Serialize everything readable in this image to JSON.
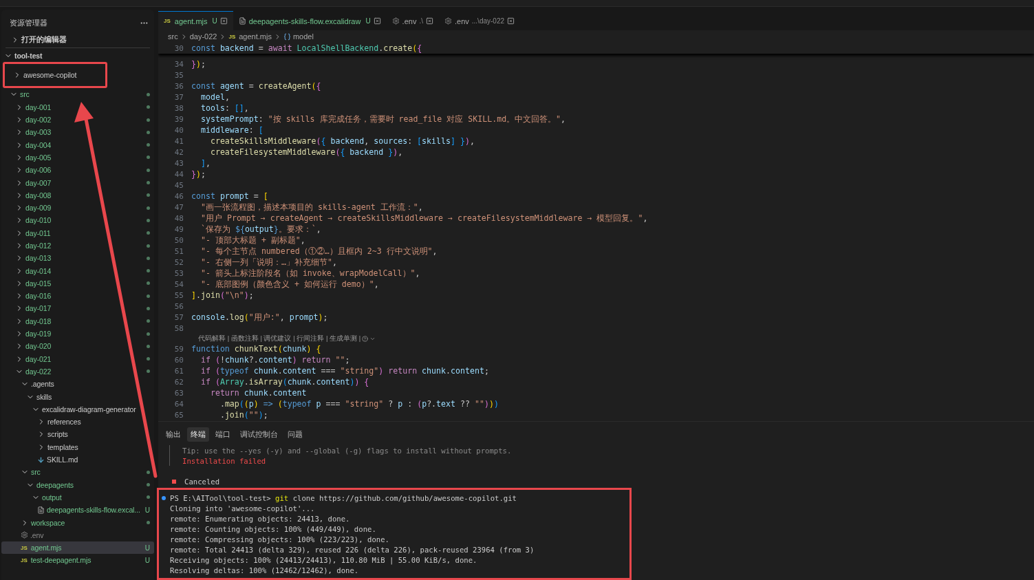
{
  "explorer": {
    "title": "资源管理器",
    "sections": [
      {
        "label": "打开的编辑器",
        "expanded": false
      }
    ],
    "root": {
      "name": "tool-test",
      "expanded": true,
      "children": [
        {
          "name": "awesome-copilot",
          "kind": "folder",
          "expanded": false,
          "untracked": false,
          "dot": false,
          "selected": false,
          "annotated": true
        },
        {
          "name": "src",
          "kind": "folder",
          "expanded": true,
          "untracked": true,
          "dot": true,
          "selected": false,
          "children": [
            {
              "name": "day-001",
              "kind": "folder",
              "expanded": false,
              "untracked": true,
              "dot": true,
              "selected": false
            },
            {
              "name": "day-002",
              "kind": "folder",
              "expanded": false,
              "untracked": true,
              "dot": true,
              "selected": false
            },
            {
              "name": "day-003",
              "kind": "folder",
              "expanded": false,
              "untracked": true,
              "dot": true,
              "selected": false
            },
            {
              "name": "day-004",
              "kind": "folder",
              "expanded": false,
              "untracked": true,
              "dot": true,
              "selected": false
            },
            {
              "name": "day-005",
              "kind": "folder",
              "expanded": false,
              "untracked": true,
              "dot": true,
              "selected": false
            },
            {
              "name": "day-006",
              "kind": "folder",
              "expanded": false,
              "untracked": true,
              "dot": true,
              "selected": false
            },
            {
              "name": "day-007",
              "kind": "folder",
              "expanded": false,
              "untracked": true,
              "dot": true,
              "selected": false
            },
            {
              "name": "day-008",
              "kind": "folder",
              "expanded": false,
              "untracked": true,
              "dot": true,
              "selected": false
            },
            {
              "name": "day-009",
              "kind": "folder",
              "expanded": false,
              "untracked": true,
              "dot": true,
              "selected": false
            },
            {
              "name": "day-010",
              "kind": "folder",
              "expanded": false,
              "untracked": true,
              "dot": true,
              "selected": false
            },
            {
              "name": "day-011",
              "kind": "folder",
              "expanded": false,
              "untracked": true,
              "dot": true,
              "selected": false
            },
            {
              "name": "day-012",
              "kind": "folder",
              "expanded": false,
              "untracked": true,
              "dot": true,
              "selected": false
            },
            {
              "name": "day-013",
              "kind": "folder",
              "expanded": false,
              "untracked": true,
              "dot": true,
              "selected": false
            },
            {
              "name": "day-014",
              "kind": "folder",
              "expanded": false,
              "untracked": true,
              "dot": true,
              "selected": false
            },
            {
              "name": "day-015",
              "kind": "folder",
              "expanded": false,
              "untracked": true,
              "dot": true,
              "selected": false
            },
            {
              "name": "day-016",
              "kind": "folder",
              "expanded": false,
              "untracked": true,
              "dot": true,
              "selected": false
            },
            {
              "name": "day-017",
              "kind": "folder",
              "expanded": false,
              "untracked": true,
              "dot": true,
              "selected": false
            },
            {
              "name": "day-018",
              "kind": "folder",
              "expanded": false,
              "untracked": true,
              "dot": true,
              "selected": false
            },
            {
              "name": "day-019",
              "kind": "folder",
              "expanded": false,
              "untracked": true,
              "dot": true,
              "selected": false
            },
            {
              "name": "day-020",
              "kind": "folder",
              "expanded": false,
              "untracked": true,
              "dot": true,
              "selected": false
            },
            {
              "name": "day-021",
              "kind": "folder",
              "expanded": false,
              "untracked": true,
              "dot": true,
              "selected": false
            },
            {
              "name": "day-022",
              "kind": "folder",
              "expanded": true,
              "untracked": true,
              "dot": true,
              "selected": false,
              "children": [
                {
                  "name": ".agents",
                  "kind": "folder",
                  "expanded": true,
                  "untracked": false,
                  "dot": false,
                  "selected": false,
                  "children": [
                    {
                      "name": "skills",
                      "kind": "folder",
                      "expanded": true,
                      "untracked": false,
                      "dot": false,
                      "selected": false,
                      "children": [
                        {
                          "name": "excalidraw-diagram-generator",
                          "kind": "folder",
                          "expanded": true,
                          "untracked": false,
                          "dot": false,
                          "selected": false,
                          "children": [
                            {
                              "name": "references",
                              "kind": "folder",
                              "expanded": false,
                              "untracked": false,
                              "dot": false,
                              "selected": false
                            },
                            {
                              "name": "scripts",
                              "kind": "folder",
                              "expanded": false,
                              "untracked": false,
                              "dot": false,
                              "selected": false
                            },
                            {
                              "name": "templates",
                              "kind": "folder",
                              "expanded": false,
                              "untracked": false,
                              "dot": false,
                              "selected": false
                            },
                            {
                              "name": "SKILL.md",
                              "kind": "markdown-file",
                              "untracked": false,
                              "dot": false,
                              "selected": false
                            }
                          ]
                        }
                      ]
                    }
                  ]
                },
                {
                  "name": "src",
                  "kind": "folder",
                  "expanded": true,
                  "untracked": true,
                  "dot": true,
                  "selected": false,
                  "children": [
                    {
                      "name": "deepagents",
                      "kind": "folder",
                      "expanded": true,
                      "untracked": true,
                      "dot": true,
                      "selected": false,
                      "children": [
                        {
                          "name": "output",
                          "kind": "folder",
                          "expanded": true,
                          "untracked": true,
                          "dot": true,
                          "selected": false,
                          "children": [
                            {
                              "name": "deepagents-skills-flow.excal...",
                              "kind": "document-file",
                              "untracked": true,
                              "dot": false,
                              "badge": "U",
                              "selected": false
                            }
                          ]
                        }
                      ]
                    }
                  ]
                },
                {
                  "name": "workspace",
                  "kind": "folder",
                  "expanded": false,
                  "untracked": true,
                  "dot": true,
                  "selected": false
                },
                {
                  "name": ".env",
                  "kind": "settings-file",
                  "untracked": false,
                  "dimmed": true,
                  "dot": false,
                  "selected": false
                },
                {
                  "name": "agent.mjs",
                  "kind": "js-file",
                  "icon_label": "JS",
                  "untracked": true,
                  "dot": false,
                  "badge": "U",
                  "selected": true
                },
                {
                  "name": "test-deepagent.mjs",
                  "kind": "js-file",
                  "icon_label": "JS",
                  "untracked": true,
                  "dot": false,
                  "badge": "U",
                  "selected": false
                }
              ]
            }
          ]
        }
      ]
    }
  },
  "tabs": [
    {
      "label": "agent.mjs",
      "kind": "js-file",
      "icon_label": "JS",
      "badge": "U",
      "untracked": true,
      "selected": true
    },
    {
      "label": "deepagents-skills-flow.excalidraw",
      "kind": "document-file",
      "badge": "U",
      "untracked": true,
      "selected": false
    },
    {
      "label": ".env",
      "kind": "settings-file",
      "description": ".\\",
      "untracked": false,
      "selected": false
    },
    {
      "label": ".env",
      "kind": "settings-file",
      "description": "...\\day-022",
      "untracked": false,
      "selected": false
    }
  ],
  "breadcrumbs": [
    {
      "label": "src",
      "kind": "folder"
    },
    {
      "label": "day-022",
      "kind": "folder"
    },
    {
      "label": "agent.mjs",
      "kind": "js-file",
      "icon_label": "JS"
    },
    {
      "label": "model",
      "kind": "symbol"
    }
  ],
  "editor": {
    "sticky_line": {
      "number": "30",
      "tokens": [
        {
          "kind": "kw",
          "text": "const "
        },
        {
          "kind": "var",
          "text": "backend"
        },
        {
          "kind": "plain",
          "text": " = "
        },
        {
          "kind": "ctl",
          "text": "await "
        },
        {
          "kind": "type",
          "text": "LocalShellBackend"
        },
        {
          "kind": "plain",
          "text": "."
        },
        {
          "kind": "fn",
          "text": "create"
        },
        {
          "kind": "br1",
          "text": "("
        },
        {
          "kind": "br2",
          "text": "{"
        }
      ]
    },
    "lines": [
      {
        "kind": "code",
        "number": "34",
        "tokens": [
          {
            "kind": "br2",
            "text": "}"
          },
          {
            "kind": "br1",
            "text": ")"
          },
          {
            "kind": "plain",
            "text": ";"
          }
        ]
      },
      {
        "kind": "code",
        "number": "35"
      },
      {
        "kind": "code",
        "number": "36",
        "tokens": [
          {
            "kind": "kw",
            "text": "const "
          },
          {
            "kind": "var",
            "text": "agent"
          },
          {
            "kind": "plain",
            "text": " = "
          },
          {
            "kind": "fn",
            "text": "createAgent"
          },
          {
            "kind": "br1",
            "text": "("
          },
          {
            "kind": "br2",
            "text": "{"
          }
        ]
      },
      {
        "kind": "code",
        "number": "37",
        "tokens": [
          {
            "kind": "var",
            "text": "  model"
          },
          {
            "kind": "plain",
            "text": ","
          }
        ]
      },
      {
        "kind": "code",
        "number": "38",
        "tokens": [
          {
            "kind": "var",
            "text": "  tools"
          },
          {
            "kind": "plain",
            "text": ": "
          },
          {
            "kind": "br3",
            "text": "[]"
          },
          {
            "kind": "plain",
            "text": ","
          }
        ]
      },
      {
        "kind": "code",
        "number": "39",
        "tokens": [
          {
            "kind": "var",
            "text": "  systemPrompt"
          },
          {
            "kind": "plain",
            "text": ": "
          },
          {
            "kind": "str",
            "text": "\"按 skills 库完成任务，需要时 read_file 对应 SKILL.md。中文回答。\""
          },
          {
            "kind": "plain",
            "text": ","
          }
        ]
      },
      {
        "kind": "code",
        "number": "40",
        "tokens": [
          {
            "kind": "var",
            "text": "  middleware"
          },
          {
            "kind": "plain",
            "text": ": "
          },
          {
            "kind": "br3",
            "text": "["
          }
        ]
      },
      {
        "kind": "code",
        "number": "41",
        "tokens": [
          {
            "kind": "fn",
            "text": "    createSkillsMiddleware"
          },
          {
            "kind": "br2",
            "text": "("
          },
          {
            "kind": "br3",
            "text": "{"
          },
          {
            "kind": "var",
            "text": " backend"
          },
          {
            "kind": "plain",
            "text": ", "
          },
          {
            "kind": "var",
            "text": "sources"
          },
          {
            "kind": "plain",
            "text": ": "
          },
          {
            "kind": "br3",
            "text": "["
          },
          {
            "kind": "var",
            "text": "skills"
          },
          {
            "kind": "br3",
            "text": "]"
          },
          {
            "kind": "br3",
            "text": " }"
          },
          {
            "kind": "br2",
            "text": ")"
          },
          {
            "kind": "plain",
            "text": ","
          }
        ]
      },
      {
        "kind": "code",
        "number": "42",
        "tokens": [
          {
            "kind": "fn",
            "text": "    createFilesystemMiddleware"
          },
          {
            "kind": "br2",
            "text": "("
          },
          {
            "kind": "br3",
            "text": "{"
          },
          {
            "kind": "var",
            "text": " backend"
          },
          {
            "kind": "br3",
            "text": " }"
          },
          {
            "kind": "br2",
            "text": ")"
          },
          {
            "kind": "plain",
            "text": ","
          }
        ]
      },
      {
        "kind": "code",
        "number": "43",
        "tokens": [
          {
            "kind": "br3",
            "text": "  ]"
          },
          {
            "kind": "plain",
            "text": ","
          }
        ]
      },
      {
        "kind": "code",
        "number": "44",
        "tokens": [
          {
            "kind": "br2",
            "text": "}"
          },
          {
            "kind": "br1",
            "text": ")"
          },
          {
            "kind": "plain",
            "text": ";"
          }
        ]
      },
      {
        "kind": "code",
        "number": "45"
      },
      {
        "kind": "code",
        "number": "46",
        "tokens": [
          {
            "kind": "kw",
            "text": "const "
          },
          {
            "kind": "var",
            "text": "prompt"
          },
          {
            "kind": "plain",
            "text": " = "
          },
          {
            "kind": "br1",
            "text": "["
          }
        ]
      },
      {
        "kind": "code",
        "number": "47",
        "tokens": [
          {
            "kind": "str",
            "text": "  \"画一张流程图，描述本项目的 skills-agent 工作流：\""
          },
          {
            "kind": "plain",
            "text": ","
          }
        ]
      },
      {
        "kind": "code",
        "number": "48",
        "tokens": [
          {
            "kind": "str",
            "text": "  \"用户 Prompt → createAgent → createSkillsMiddleware → createFilesystemMiddleware → 模型回复。\""
          },
          {
            "kind": "plain",
            "text": ","
          }
        ]
      },
      {
        "kind": "code",
        "number": "49",
        "tokens": [
          {
            "kind": "str",
            "text": "  `保存为 "
          },
          {
            "kind": "kw",
            "text": "${"
          },
          {
            "kind": "var",
            "text": "output"
          },
          {
            "kind": "kw",
            "text": "}"
          },
          {
            "kind": "str",
            "text": "。要求：`"
          },
          {
            "kind": "plain",
            "text": ","
          }
        ]
      },
      {
        "kind": "code",
        "number": "50",
        "tokens": [
          {
            "kind": "str",
            "text": "  \"- 顶部大标题 + 副标题\""
          },
          {
            "kind": "plain",
            "text": ","
          }
        ]
      },
      {
        "kind": "code",
        "number": "51",
        "tokens": [
          {
            "kind": "str",
            "text": "  \"- 每个主节点 numbered（①②…）且框内 2~3 行中文说明\""
          },
          {
            "kind": "plain",
            "text": ","
          }
        ]
      },
      {
        "kind": "code",
        "number": "52",
        "tokens": [
          {
            "kind": "str",
            "text": "  \"- 右侧一列「说明：…」补充细节\""
          },
          {
            "kind": "plain",
            "text": ","
          }
        ]
      },
      {
        "kind": "code",
        "number": "53",
        "tokens": [
          {
            "kind": "str",
            "text": "  \"- 箭头上标注阶段名（如 invoke、wrapModelCall）\""
          },
          {
            "kind": "plain",
            "text": ","
          }
        ]
      },
      {
        "kind": "code",
        "number": "54",
        "tokens": [
          {
            "kind": "str",
            "text": "  \"- 底部图例（颜色含义 + 如何运行 demo）\""
          },
          {
            "kind": "plain",
            "text": ","
          }
        ]
      },
      {
        "kind": "code",
        "number": "55",
        "tokens": [
          {
            "kind": "br1",
            "text": "]"
          },
          {
            "kind": "plain",
            "text": "."
          },
          {
            "kind": "fn",
            "text": "join"
          },
          {
            "kind": "br2",
            "text": "("
          },
          {
            "kind": "str",
            "text": "\"\\n\""
          },
          {
            "kind": "br2",
            "text": ")"
          },
          {
            "kind": "plain",
            "text": ";"
          }
        ]
      },
      {
        "kind": "code",
        "number": "56"
      },
      {
        "kind": "code",
        "number": "57",
        "tokens": [
          {
            "kind": "var",
            "text": "console"
          },
          {
            "kind": "plain",
            "text": "."
          },
          {
            "kind": "fn",
            "text": "log"
          },
          {
            "kind": "br1",
            "text": "("
          },
          {
            "kind": "str",
            "text": "\"用户:\""
          },
          {
            "kind": "plain",
            "text": ", "
          },
          {
            "kind": "var",
            "text": "prompt"
          },
          {
            "kind": "br1",
            "text": ")"
          },
          {
            "kind": "plain",
            "text": ";"
          }
        ]
      },
      {
        "kind": "code",
        "number": "58"
      },
      {
        "kind": "lens",
        "text": "代码解释 | 函数注释 | 调优建议 | 行间注释 | 生成单测 |"
      },
      {
        "kind": "code",
        "number": "59",
        "tokens": [
          {
            "kind": "kw",
            "text": "function "
          },
          {
            "kind": "fn",
            "text": "chunkText"
          },
          {
            "kind": "br1",
            "text": "("
          },
          {
            "kind": "var",
            "text": "chunk"
          },
          {
            "kind": "br1",
            "text": ")"
          },
          {
            "kind": "br1",
            "text": " {"
          }
        ]
      },
      {
        "kind": "code",
        "number": "60",
        "tokens": [
          {
            "kind": "ctl",
            "text": "  if "
          },
          {
            "kind": "br2",
            "text": "("
          },
          {
            "kind": "plain",
            "text": "!"
          },
          {
            "kind": "var",
            "text": "chunk"
          },
          {
            "kind": "plain",
            "text": "?."
          },
          {
            "kind": "var",
            "text": "content"
          },
          {
            "kind": "br2",
            "text": ")"
          },
          {
            "kind": "ctl",
            "text": " return "
          },
          {
            "kind": "str",
            "text": "\"\""
          },
          {
            "kind": "plain",
            "text": ";"
          }
        ]
      },
      {
        "kind": "code",
        "number": "61",
        "tokens": [
          {
            "kind": "ctl",
            "text": "  if "
          },
          {
            "kind": "br2",
            "text": "("
          },
          {
            "kind": "kw",
            "text": "typeof "
          },
          {
            "kind": "var",
            "text": "chunk"
          },
          {
            "kind": "plain",
            "text": "."
          },
          {
            "kind": "var",
            "text": "content"
          },
          {
            "kind": "plain",
            "text": " === "
          },
          {
            "kind": "str",
            "text": "\"string\""
          },
          {
            "kind": "br2",
            "text": ")"
          },
          {
            "kind": "ctl",
            "text": " return "
          },
          {
            "kind": "var",
            "text": "chunk"
          },
          {
            "kind": "plain",
            "text": "."
          },
          {
            "kind": "var",
            "text": "content"
          },
          {
            "kind": "plain",
            "text": ";"
          }
        ]
      },
      {
        "kind": "code",
        "number": "62",
        "tokens": [
          {
            "kind": "ctl",
            "text": "  if "
          },
          {
            "kind": "br2",
            "text": "("
          },
          {
            "kind": "type",
            "text": "Array"
          },
          {
            "kind": "plain",
            "text": "."
          },
          {
            "kind": "fn",
            "text": "isArray"
          },
          {
            "kind": "br3",
            "text": "("
          },
          {
            "kind": "var",
            "text": "chunk"
          },
          {
            "kind": "plain",
            "text": "."
          },
          {
            "kind": "var",
            "text": "content"
          },
          {
            "kind": "br3",
            "text": ")"
          },
          {
            "kind": "br2",
            "text": ")"
          },
          {
            "kind": "br2",
            "text": " {"
          }
        ]
      },
      {
        "kind": "code",
        "number": "63",
        "tokens": [
          {
            "kind": "ctl",
            "text": "    return "
          },
          {
            "kind": "var",
            "text": "chunk"
          },
          {
            "kind": "plain",
            "text": "."
          },
          {
            "kind": "var",
            "text": "content"
          }
        ]
      },
      {
        "kind": "code",
        "number": "64",
        "tokens": [
          {
            "kind": "plain",
            "text": "      ."
          },
          {
            "kind": "fn",
            "text": "map"
          },
          {
            "kind": "br3",
            "text": "("
          },
          {
            "kind": "br1",
            "text": "("
          },
          {
            "kind": "var",
            "text": "p"
          },
          {
            "kind": "br1",
            "text": ")"
          },
          {
            "kind": "kw",
            "text": " => "
          },
          {
            "kind": "br1",
            "text": "("
          },
          {
            "kind": "kw",
            "text": "typeof "
          },
          {
            "kind": "var",
            "text": "p"
          },
          {
            "kind": "plain",
            "text": " === "
          },
          {
            "kind": "str",
            "text": "\"string\""
          },
          {
            "kind": "plain",
            "text": " ? "
          },
          {
            "kind": "var",
            "text": "p"
          },
          {
            "kind": "plain",
            "text": " : "
          },
          {
            "kind": "br2",
            "text": "("
          },
          {
            "kind": "var",
            "text": "p"
          },
          {
            "kind": "plain",
            "text": "?."
          },
          {
            "kind": "var",
            "text": "text"
          },
          {
            "kind": "plain",
            "text": " ?? "
          },
          {
            "kind": "str",
            "text": "\"\""
          },
          {
            "kind": "br2",
            "text": ")"
          },
          {
            "kind": "br1",
            "text": ")"
          },
          {
            "kind": "br3",
            "text": ")"
          }
        ]
      },
      {
        "kind": "code",
        "number": "65",
        "tokens": [
          {
            "kind": "plain",
            "text": "      ."
          },
          {
            "kind": "fn",
            "text": "join"
          },
          {
            "kind": "br3",
            "text": "("
          },
          {
            "kind": "str",
            "text": "\"\""
          },
          {
            "kind": "br3",
            "text": ")"
          },
          {
            "kind": "plain",
            "text": ";"
          }
        ]
      }
    ]
  },
  "panel": {
    "tabs": [
      {
        "label": "输出",
        "selected": false
      },
      {
        "label": "终端",
        "selected": true
      },
      {
        "label": "端口",
        "selected": false
      },
      {
        "label": "调试控制台",
        "selected": false
      },
      {
        "label": "问题",
        "selected": false
      }
    ],
    "sections": [
      {
        "annotated": false,
        "lines": [
          {
            "kind": "tip",
            "text": "Tip: use the --yes (-y) and --global (-g) flags to install without prompts."
          },
          {
            "kind": "error",
            "text": "Installation failed"
          },
          {
            "kind": "blank"
          },
          {
            "kind": "canceled",
            "text": "Canceled"
          }
        ]
      },
      {
        "annotated": true,
        "lines": [
          {
            "kind": "prompt",
            "prompt": "PS E:\\AITool\\tool-test>",
            "command": "git",
            "args": "clone https://github.com/github/awesome-copilot.git"
          },
          {
            "kind": "output",
            "text": "Cloning into 'awesome-copilot'..."
          },
          {
            "kind": "output",
            "text": "remote: Enumerating objects: 24413, done."
          },
          {
            "kind": "output",
            "text": "remote: Counting objects: 100% (449/449), done."
          },
          {
            "kind": "output",
            "text": "remote: Compressing objects: 100% (223/223), done."
          },
          {
            "kind": "output",
            "text": "remote: Total 24413 (delta 329), reused 226 (delta 226), pack-reused 23964 (from 3)"
          },
          {
            "kind": "output",
            "text": "Receiving objects: 100% (24413/24413), 110.80 MiB | 55.00 KiB/s, done."
          },
          {
            "kind": "output",
            "text": "Resolving deltas: 100% (12462/12462), done."
          }
        ]
      }
    ]
  }
}
